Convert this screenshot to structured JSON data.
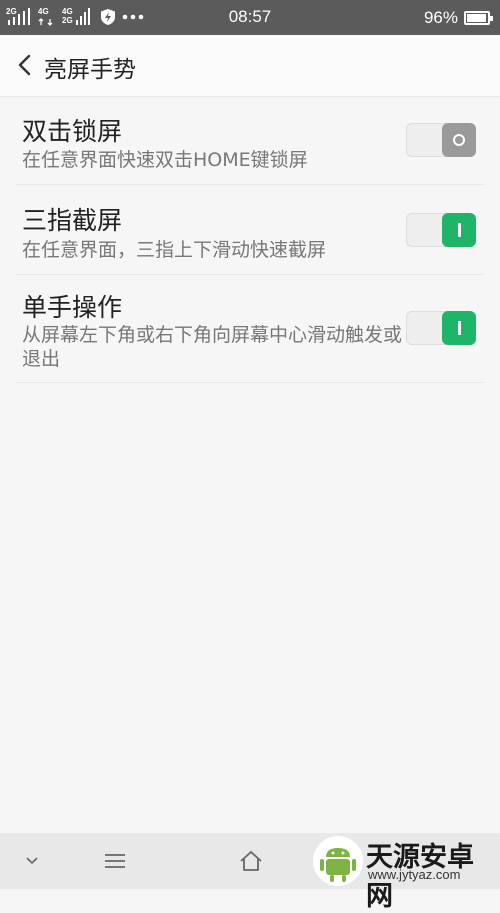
{
  "status_bar": {
    "signal1_label": "2G",
    "signal2_label_top": "4G",
    "signal3_label_top": "4G",
    "signal3_label_bottom": "2G",
    "time": "08:57",
    "battery_percent": "96%",
    "battery_level": 0.96,
    "icons": [
      "signal-icon",
      "signal-icon",
      "signal-icon",
      "shield-icon",
      "more-dots-icon",
      "battery-icon"
    ]
  },
  "app_bar": {
    "title": "亮屏手势"
  },
  "settings": [
    {
      "title": "双击锁屏",
      "subtitle": "在任意界面快速双击HOME键锁屏",
      "enabled": false
    },
    {
      "title": "三指截屏",
      "subtitle": "在任意界面，三指上下滑动快速截屏",
      "enabled": true
    },
    {
      "title": "单手操作",
      "subtitle": "从屏幕左下角或右下角向屏幕中心滑动触发或退出",
      "enabled": true
    }
  ],
  "nav_bar": {
    "icons": [
      "chevron-down-icon",
      "menu-icon",
      "home-icon"
    ]
  },
  "watermark": {
    "name": "天源安卓网",
    "url": "www.jytyaz.com"
  },
  "colors": {
    "toggle_on": "#1fb568",
    "toggle_off": "#9a9a9a",
    "status_bar": "#5b5b5b"
  }
}
